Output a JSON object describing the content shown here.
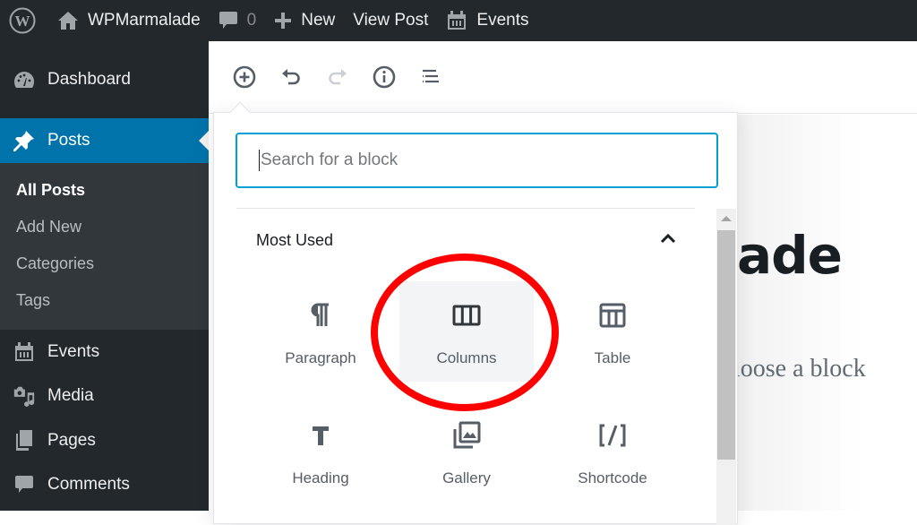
{
  "admin_bar": {
    "site_name": "WPMarmalade",
    "comments_count": "0",
    "new_label": "New",
    "view_post_label": "View Post",
    "events_label": "Events"
  },
  "sidebar": {
    "items": [
      {
        "label": "Dashboard",
        "icon": "dashboard-icon"
      },
      {
        "label": "Posts",
        "icon": "pin-icon",
        "active": true
      },
      {
        "label": "Events",
        "icon": "calendar-icon"
      },
      {
        "label": "Media",
        "icon": "media-icon"
      },
      {
        "label": "Pages",
        "icon": "pages-icon"
      },
      {
        "label": "Comments",
        "icon": "comment-icon"
      }
    ],
    "submenu": [
      {
        "label": "All Posts",
        "current": true
      },
      {
        "label": "Add New"
      },
      {
        "label": "Categories"
      },
      {
        "label": "Tags"
      }
    ]
  },
  "editor": {
    "toolbar": [
      "add-block",
      "undo",
      "redo",
      "info",
      "outline"
    ],
    "title_fragment": "ade",
    "appender_fragment": "ıoose a block"
  },
  "inserter": {
    "search_placeholder": "Search for a block",
    "panel_title": "Most Used",
    "blocks": [
      {
        "label": "Paragraph",
        "icon": "paragraph-icon"
      },
      {
        "label": "Columns",
        "icon": "columns-icon",
        "highlighted": true
      },
      {
        "label": "Table",
        "icon": "table-icon"
      },
      {
        "label": "Heading",
        "icon": "heading-icon"
      },
      {
        "label": "Gallery",
        "icon": "gallery-icon"
      },
      {
        "label": "Shortcode",
        "icon": "shortcode-icon"
      }
    ]
  },
  "colors": {
    "admin_bar_bg": "#23282d",
    "active_menu_bg": "#0073aa",
    "submenu_bg": "#32373c",
    "search_focus": "#00a0d2",
    "highlight_ring": "#ff0000"
  }
}
